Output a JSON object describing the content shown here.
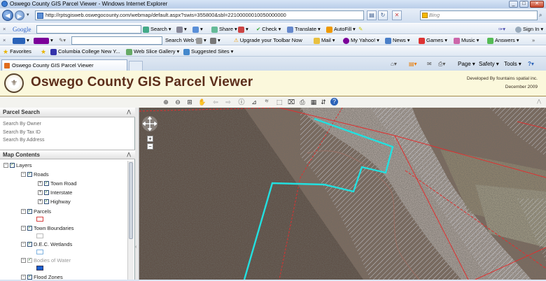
{
  "window": {
    "title": "Oswego County GIS Parcel Viewer - Windows Internet Explorer",
    "controls": {
      "minimize": "_",
      "maximize": "□",
      "close": "✕"
    }
  },
  "address_bar": {
    "url": "http://rptsgisweb.oswegocounty.com/webmap/default.aspx?swis=355800&sbl=22100000010050000000",
    "search_placeholder": "Bing"
  },
  "google_toolbar": {
    "close": "×",
    "brand": "Google",
    "search_label": "Search",
    "share_label": "Share",
    "check_label": "Check",
    "translate_label": "Translate",
    "autofill_label": "AutoFill",
    "signin_label": "Sign In"
  },
  "yahoo_toolbar": {
    "close": "×",
    "search_web_label": "Search Web",
    "upgrade_label": "Upgrade your Toolbar Now",
    "mail_label": "Mail",
    "myyahoo_label": "My Yahoo!",
    "news_label": "News",
    "games_label": "Games",
    "music_label": "Music",
    "answers_label": "Answers"
  },
  "favorites_bar": {
    "favorites_label": "Favorites",
    "items": [
      "Columbia College New Y...",
      "Web Slice Gallery",
      "Suggested Sites"
    ]
  },
  "tab": {
    "label": "Oswego County GIS Parcel Viewer"
  },
  "command_bar": {
    "page_label": "Page",
    "safety_label": "Safety",
    "tools_label": "Tools"
  },
  "app": {
    "title": "Oswego County GIS Parcel Viewer",
    "seal": "⚜",
    "credit_line1": "Developed By fountains spatial inc.",
    "credit_line2": "December 2009"
  },
  "map_tools": [
    "zoom-in",
    "zoom-out",
    "full-extent",
    "pan",
    "previous-extent",
    "next-extent",
    "identify",
    "measure",
    "xy",
    "select",
    "clear",
    "print",
    "export",
    "sort",
    "help"
  ],
  "parcel_search": {
    "header": "Parcel Search",
    "items": [
      "Search By Owner",
      "Search By Tax ID",
      "Search By Address"
    ]
  },
  "map_contents": {
    "header": "Map Contents",
    "layers_label": "Layers",
    "roads_label": "Roads",
    "town_road_label": "Town Road",
    "interstate_label": "Interstate",
    "highway_label": "Highway",
    "parcels_label": "Parcels",
    "town_boundaries_label": "Town Boundaries",
    "dec_wetlands_label": "D.E.C. Wetlands",
    "bodies_of_water_label": "Bodies of Water",
    "flood_zones_label": "Flood Zones",
    "colors": {
      "parcels": "#d84040",
      "town_boundaries": "#bbbbbb",
      "dec_wetlands": "#7fb2e0",
      "bodies_of_water": "#1a5fd0"
    }
  },
  "map": {
    "highlight_color": "#22e0e0",
    "parcel_line_color": "#e03030",
    "nav_arrows": "✥",
    "zoom_in": "+",
    "zoom_out": "−"
  }
}
